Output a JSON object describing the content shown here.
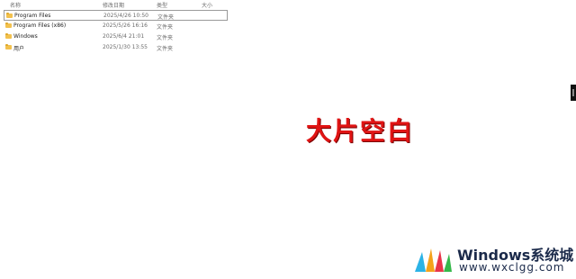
{
  "columns": {
    "name": "名称",
    "date": "修改日期",
    "type": "类型",
    "size": "大小"
  },
  "files": [
    {
      "name": "Program Files",
      "date": "2025/4/26 10:50",
      "type": "文件夹",
      "selected": true
    },
    {
      "name": "Program Files (x86)",
      "date": "2025/5/26 16:16",
      "type": "文件夹"
    },
    {
      "name": "Windows",
      "date": "2025/6/4 21:01",
      "type": "文件夹"
    },
    {
      "name": "用户",
      "date": "2025/1/30 13:55",
      "type": "文件夹"
    }
  ],
  "overlay": {
    "text": "大片空白",
    "color": "#e01414"
  },
  "watermark": {
    "title": "Windows系统城",
    "url": "www.wxclgg.com"
  },
  "colors": {
    "folder": "#f2c14e",
    "accent": "#e01414"
  }
}
